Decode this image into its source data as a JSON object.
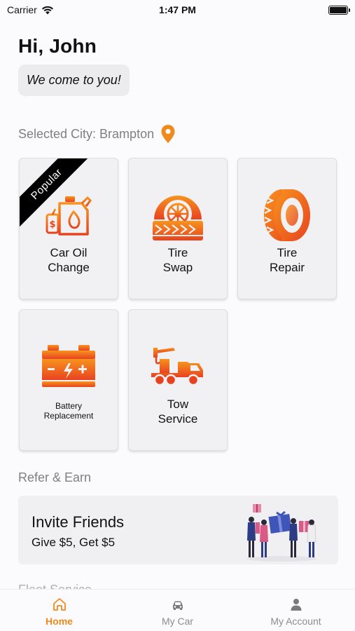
{
  "status_bar": {
    "carrier": "Carrier",
    "time": "1:47 PM"
  },
  "greeting": "Hi, John",
  "tagline": "We come to you!",
  "city": {
    "text": "Selected City: Brampton"
  },
  "services": [
    {
      "label_lines": [
        "Car Oil",
        "Change"
      ],
      "badge": "Popular",
      "icon": "oil-can-icon"
    },
    {
      "label_lines": [
        "Tire",
        "Swap"
      ],
      "icon": "tire-swap-icon"
    },
    {
      "label_lines": [
        "Tire",
        "Repair"
      ],
      "icon": "tire-icon"
    },
    {
      "label_lines": [
        "Battery",
        "Replacement"
      ],
      "icon": "battery-icon"
    },
    {
      "label_lines": [
        "Tow",
        "Service"
      ],
      "icon": "tow-truck-icon"
    }
  ],
  "refer_section": {
    "title": "Refer & Earn",
    "card_title": "Invite Friends",
    "card_subtitle": "Give $5, Get $5"
  },
  "next_section_title": "Fleet Service",
  "tabs": [
    {
      "label": "Home",
      "icon": "home-icon",
      "active": true
    },
    {
      "label": "My Car",
      "icon": "car-icon",
      "active": false
    },
    {
      "label": "My Account",
      "icon": "person-icon",
      "active": false
    }
  ],
  "colors": {
    "accent": "#f08a1c",
    "icon_red": "#e8431f"
  }
}
